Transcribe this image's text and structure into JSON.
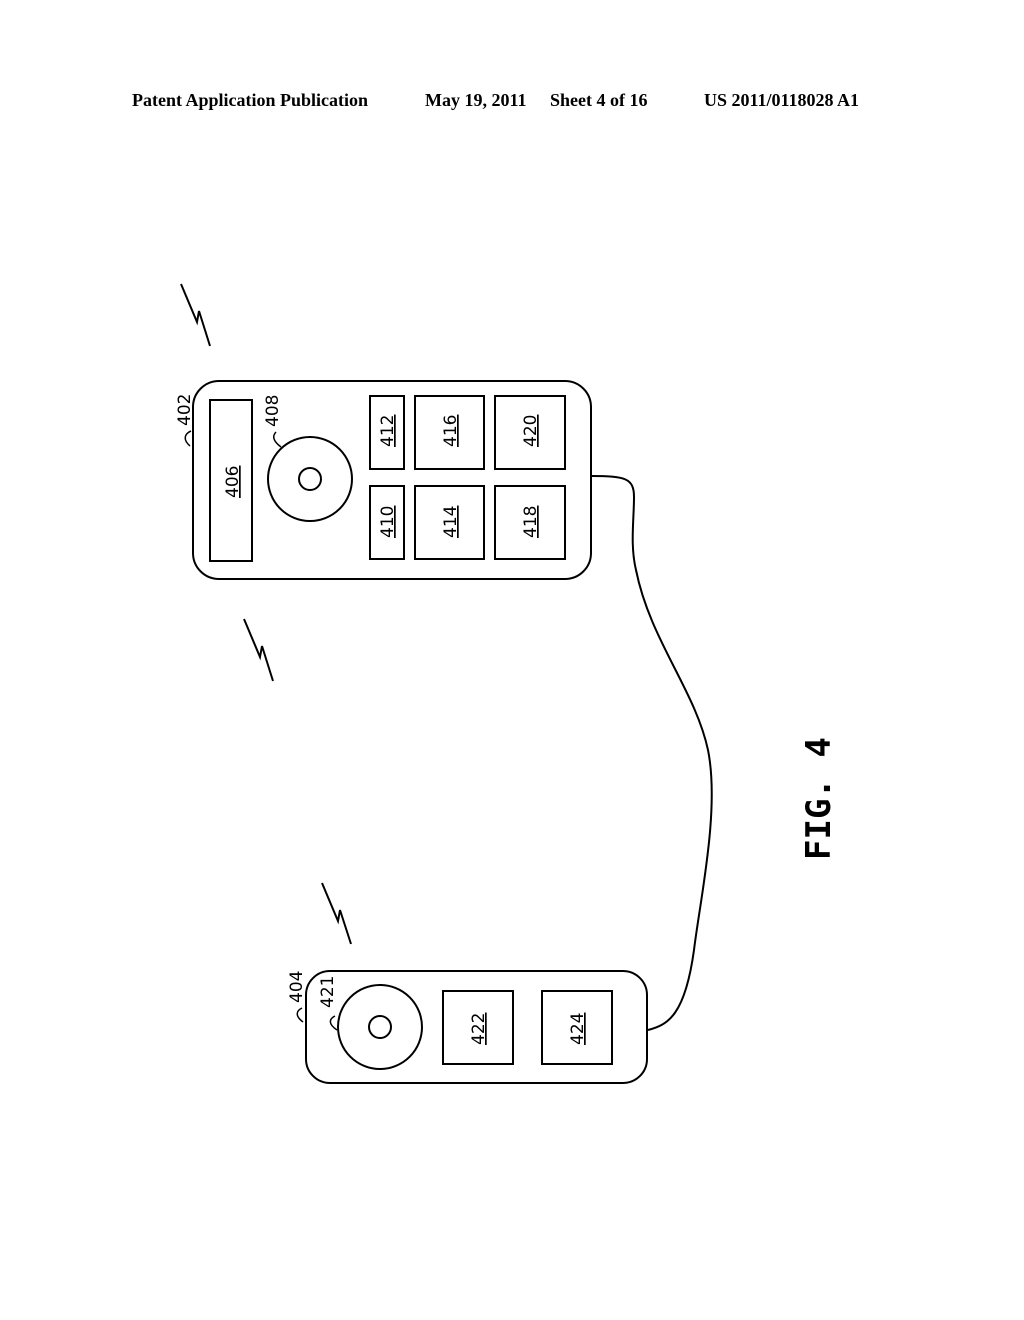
{
  "header": {
    "publication_type": "Patent Application Publication",
    "date": "May 19, 2011",
    "sheet": "Sheet 4 of 16",
    "publication_number": "US 2011/0118028 A1"
  },
  "figure": {
    "caption": "FIG. 4",
    "device_402": {
      "ref": "402",
      "display_ref": "406",
      "wheel_ref": "408",
      "buttons": [
        "410",
        "412",
        "414",
        "416",
        "418",
        "420"
      ]
    },
    "device_404": {
      "ref": "404",
      "wheel_ref": "421",
      "buttons": [
        "422",
        "424"
      ]
    },
    "wireless_symbols": [
      "wireless-signal-top",
      "wireless-signal-middle",
      "wireless-signal-bottom"
    ],
    "connection": "cable linking device 402 and device 404"
  }
}
